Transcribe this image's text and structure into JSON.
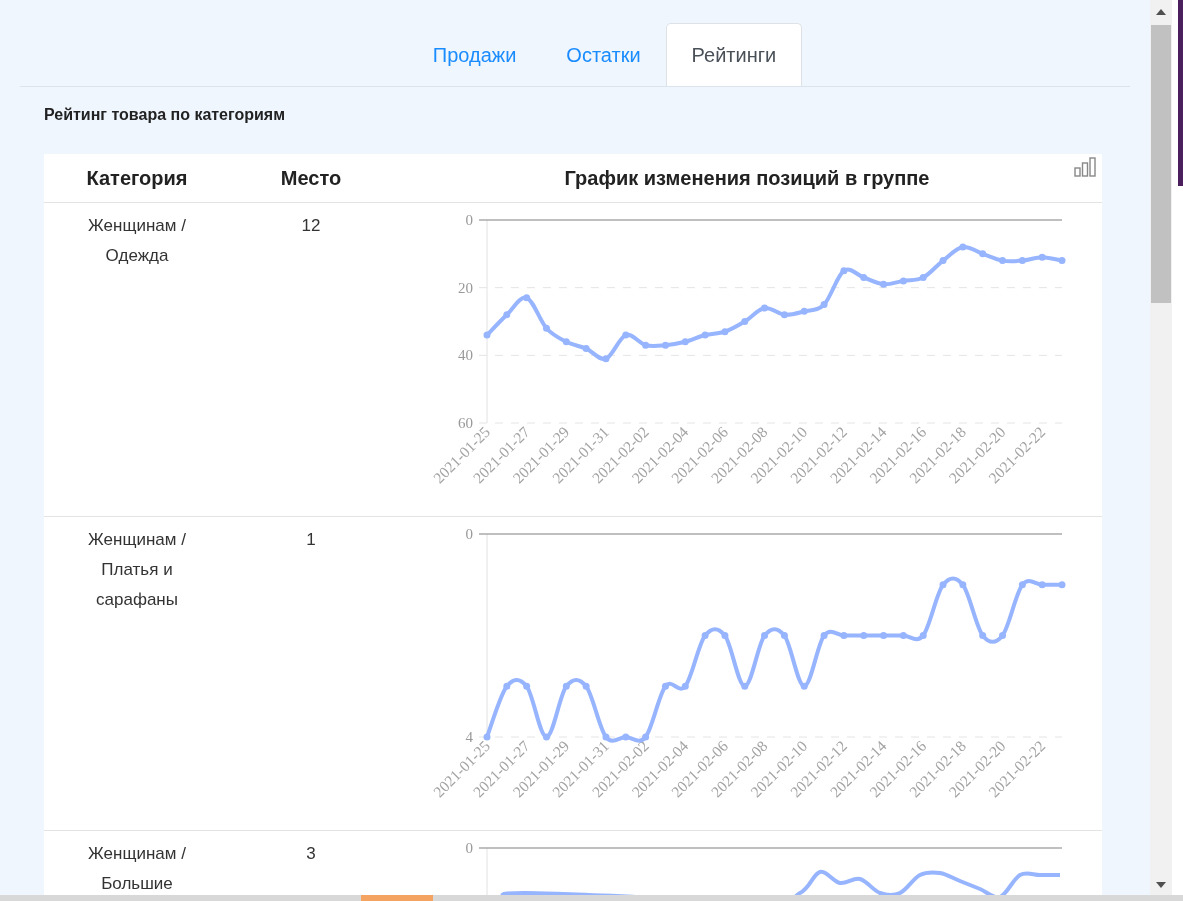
{
  "tabs": [
    {
      "label": "Продажи",
      "selected": false
    },
    {
      "label": "Остатки",
      "selected": false
    },
    {
      "label": "Рейтинги",
      "selected": true
    }
  ],
  "section_title": "Рейтинг товара по категориям",
  "table": {
    "columns": [
      "Категория",
      "Место",
      "График изменения позиций в группе"
    ],
    "rows": [
      {
        "category": "Женщинам / Одежда",
        "place": "12",
        "chart_data": {
          "type": "line",
          "ylim": [
            60,
            0
          ],
          "yticks": [
            0,
            20,
            40,
            60
          ],
          "categories": [
            "2021-01-25",
            null,
            "2021-01-27",
            null,
            "2021-01-29",
            null,
            "2021-01-31",
            null,
            "2021-02-02",
            null,
            "2021-02-04",
            null,
            "2021-02-06",
            null,
            "2021-02-08",
            null,
            "2021-02-10",
            null,
            "2021-02-12",
            null,
            "2021-02-14",
            null,
            "2021-02-16",
            null,
            "2021-02-18",
            null,
            "2021-02-20",
            null,
            "2021-02-22",
            null
          ],
          "series": [
            {
              "color": "#97b4ff",
              "marker": "circle",
              "values": [
                34,
                28,
                23,
                32,
                36,
                38,
                41,
                34,
                37,
                37,
                36,
                34,
                33,
                30,
                26,
                28,
                27,
                25,
                15,
                17,
                19,
                18,
                17,
                12,
                8,
                10,
                12,
                12,
                11,
                12
              ]
            }
          ]
        }
      },
      {
        "category": "Женщинам / Платья и сарафаны",
        "place": "1",
        "chart_data": {
          "type": "line",
          "ylim": [
            4,
            0
          ],
          "yticks": [
            0,
            4
          ],
          "categories": [
            "2021-01-25",
            null,
            "2021-01-27",
            null,
            "2021-01-29",
            null,
            "2021-01-31",
            null,
            "2021-02-02",
            null,
            "2021-02-04",
            null,
            "2021-02-06",
            null,
            "2021-02-08",
            null,
            "2021-02-10",
            null,
            "2021-02-12",
            null,
            "2021-02-14",
            null,
            "2021-02-16",
            null,
            "2021-02-18",
            null,
            "2021-02-20",
            null,
            "2021-02-22",
            null
          ],
          "series": [
            {
              "color": "#97b4ff",
              "marker": "circle",
              "values": [
                4,
                3,
                3,
                4,
                3,
                3,
                4,
                4,
                4,
                3,
                3,
                2,
                2,
                3,
                2,
                2,
                3,
                2,
                2,
                2,
                2,
                2,
                2,
                1,
                1,
                2,
                2,
                1,
                1,
                1
              ]
            }
          ]
        }
      },
      {
        "category": "Женщинам / Большие",
        "place": "3",
        "chart_top_tick": "0"
      }
    ]
  }
}
